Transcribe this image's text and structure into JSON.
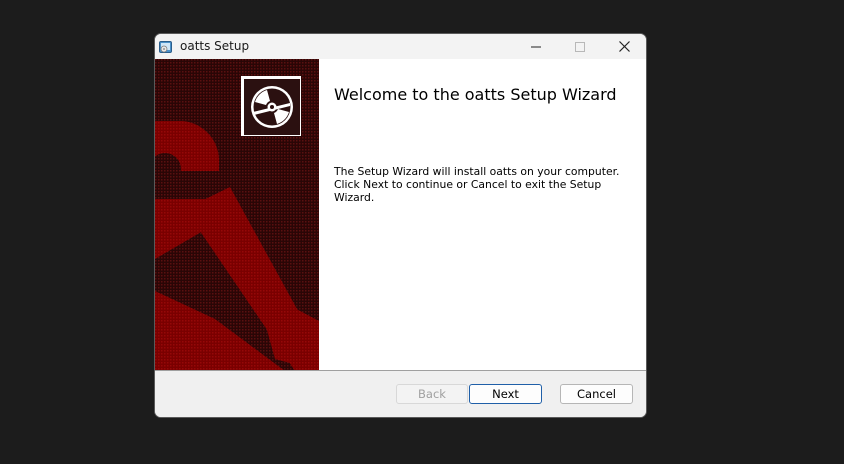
{
  "window": {
    "title": "oatts Setup",
    "icon": "installer-icon"
  },
  "titlebar_buttons": {
    "minimize": "minimize-icon",
    "maximize": "maximize-icon",
    "close": "close-icon"
  },
  "sidebar": {
    "logo": "disc-icon",
    "colors": {
      "background": "#3a0a0a",
      "accent": "#8b0000"
    }
  },
  "main": {
    "heading": "Welcome to the oatts Setup Wizard",
    "description": "The Setup Wizard will install oatts on your computer. Click Next to continue or Cancel to exit the Setup Wizard."
  },
  "footer": {
    "back_label": "Back",
    "next_label": "Next",
    "cancel_label": "Cancel",
    "back_enabled": false
  },
  "colors": {
    "desktop": "#1c1c1c",
    "focus_border": "#1f5fa8"
  }
}
